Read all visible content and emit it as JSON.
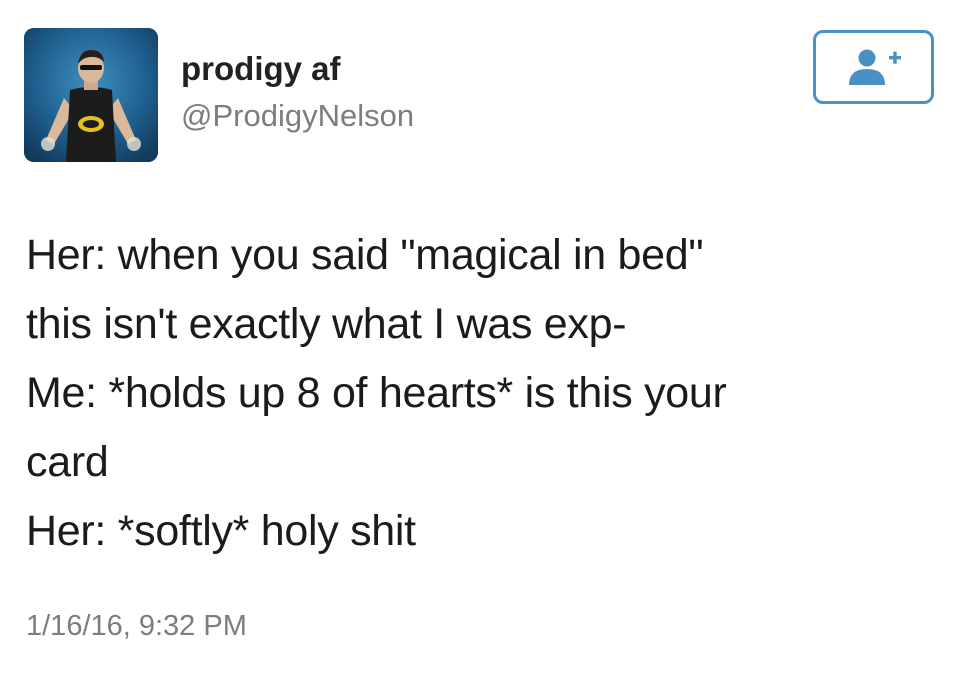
{
  "tweet": {
    "user": {
      "display_name": "prodigy af",
      "handle": "@ProdigyNelson",
      "avatar": "avatar-image"
    },
    "follow_button": {
      "icon": "add-user-icon",
      "color": "#4a90c2"
    },
    "text_lines": [
      "Her: when you said \"magical in bed\"",
      "this isn't exactly what I was exp-",
      "Me: *holds up 8 of hearts* is this your",
      "card",
      "Her: *softly* holy shit"
    ],
    "timestamp": "1/16/16, 9:32 PM"
  }
}
